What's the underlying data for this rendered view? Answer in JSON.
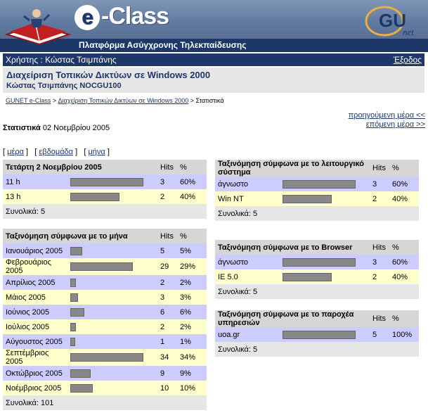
{
  "banner": {
    "brand": "-Class",
    "brand_e": "e",
    "subtitle": "Πλατφόρμα Ασύγχρονης Τηλεκπαίδευσης",
    "partner_logo": "GU net"
  },
  "userbar": {
    "user": "Χρήστης : Κώστας Τσιμπάνης",
    "logout": "Έξοδος"
  },
  "course": {
    "title": "Διαχείριση Τοπικών Δικτύων σε Windows 2000",
    "professor": "Κώστας Τσιμπάνης NOCGU100"
  },
  "breadcrumb": {
    "home": "GUNET e-Class",
    "sep1": " > ",
    "course": "Διαχείριση Τοπικών Δικτύων σε Windows 2000",
    "sep2": " > ",
    "current": "Στατιστικά"
  },
  "nav": {
    "prev_day": "προηγούμενη μέρα <<",
    "next_day": "επόμενη μέρα >>"
  },
  "stats": {
    "label": "Στατιστικά",
    "date": " 02 Νοεμβρίου 2005"
  },
  "periods": {
    "day": "μέρα",
    "week": "εβδομάδα",
    "month": "μήνα"
  },
  "colors": {
    "header_blue": "#1d3768",
    "row_blue": "#ccccff",
    "row_yellow": "#ffffcc",
    "header_grey": "#d6d6d6"
  },
  "tables": {
    "hours": {
      "title": "Τετάρτη 2 Νοεμβρίου 2005",
      "hits_label": "Hits",
      "pct_label": "%",
      "rows": [
        {
          "label": "11 h",
          "hits": "3",
          "pct": "60%",
          "value": 0.6
        },
        {
          "label": "13 h",
          "hits": "2",
          "pct": "40%",
          "value": 0.4
        }
      ],
      "total": "Συνολικά: 5"
    },
    "months": {
      "title": "Ταξινόμηση σύμφωνα με το μήνα",
      "hits_label": "Hits",
      "pct_label": "%",
      "rows": [
        {
          "label": "Ιανουάριος 2005",
          "hits": "5",
          "pct": "5%",
          "value": 0.05
        },
        {
          "label": "Φεβρουάριος 2005",
          "hits": "29",
          "pct": "29%",
          "value": 0.29
        },
        {
          "label": "Απρίλιος 2005",
          "hits": "2",
          "pct": "2%",
          "value": 0.02
        },
        {
          "label": "Μάιος 2005",
          "hits": "3",
          "pct": "3%",
          "value": 0.03
        },
        {
          "label": "Ιούνιος 2005",
          "hits": "6",
          "pct": "6%",
          "value": 0.06
        },
        {
          "label": "Ιούλιος 2005",
          "hits": "2",
          "pct": "2%",
          "value": 0.02
        },
        {
          "label": "Αύγουστος 2005",
          "hits": "1",
          "pct": "1%",
          "value": 0.01
        },
        {
          "label": "Σεπτέμβριος 2005",
          "hits": "34",
          "pct": "34%",
          "value": 0.34
        },
        {
          "label": "Οκτώβριος 2005",
          "hits": "9",
          "pct": "9%",
          "value": 0.09
        },
        {
          "label": "Νοέμβριος 2005",
          "hits": "10",
          "pct": "10%",
          "value": 0.1
        }
      ],
      "total": "Συνολικά: 101"
    },
    "os": {
      "title": "Ταξινόμηση σύμφωνα με το λειτουργικό σύστημα",
      "hits_label": "Hits",
      "pct_label": "%",
      "rows": [
        {
          "label": "άγνωστο",
          "hits": "3",
          "pct": "60%",
          "value": 0.6
        },
        {
          "label": "Win NT",
          "hits": "2",
          "pct": "40%",
          "value": 0.4
        }
      ],
      "total": "Συνολικά: 5"
    },
    "browser": {
      "title": "Ταξινόμηση σύμφωνα με το Browser",
      "hits_label": "Hits",
      "pct_label": "%",
      "rows": [
        {
          "label": "άγνωστο",
          "hits": "3",
          "pct": "60%",
          "value": 0.6
        },
        {
          "label": "IE 5.0",
          "hits": "2",
          "pct": "40%",
          "value": 0.4
        }
      ],
      "total": "Συνολικά: 5"
    },
    "provider": {
      "title": "Ταξινόμηση σύμφωνα με το παροχέα υπηρεσιών",
      "hits_label": "Hits",
      "pct_label": "%",
      "rows": [
        {
          "label": "uoa.gr",
          "hits": "5",
          "pct": "100%",
          "value": 1.0
        }
      ],
      "total": "Συνολικά: 5"
    }
  }
}
